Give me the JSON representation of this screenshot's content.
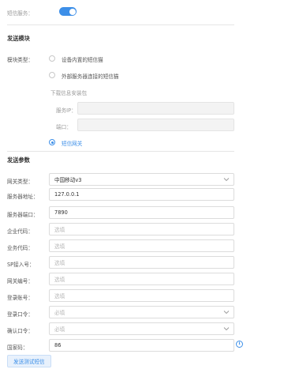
{
  "sms_service": {
    "label": "短信服务：",
    "enabled": true
  },
  "send_module": {
    "title": "发送模块",
    "module_type_label": "模块类型：",
    "options": [
      {
        "label": "设备内置的短信猫",
        "selected": false
      },
      {
        "label": "外部服务器连接的短信猫",
        "selected": false
      },
      {
        "label": "短信网关",
        "selected": true
      }
    ],
    "download_hint": "下载信息安装包",
    "server_ip_label": "服务IP：",
    "port_label": "端口："
  },
  "send_params": {
    "title": "发送参数",
    "fields": [
      {
        "label": "网关类型：",
        "value": "中国移动v3",
        "placeholder": "",
        "type": "select"
      },
      {
        "label": "服务器地址：",
        "value": "127.0.0.1",
        "placeholder": "",
        "type": "text"
      },
      {
        "label": "服务器端口：",
        "value": "7890",
        "placeholder": "",
        "type": "text"
      },
      {
        "label": "企业代码：",
        "value": "",
        "placeholder": "选填",
        "type": "text"
      },
      {
        "label": "业务代码：",
        "value": "",
        "placeholder": "选填",
        "type": "text"
      },
      {
        "label": "SP接入号：",
        "value": "",
        "placeholder": "选填",
        "type": "text"
      },
      {
        "label": "网关编号：",
        "value": "",
        "placeholder": "选填",
        "type": "text"
      },
      {
        "label": "登录账号：",
        "value": "",
        "placeholder": "选填",
        "type": "text"
      },
      {
        "label": "登录口令：",
        "value": "",
        "placeholder": "必填",
        "type": "password"
      },
      {
        "label": "确认口令：",
        "value": "",
        "placeholder": "必填",
        "type": "password"
      },
      {
        "label": "国家码：",
        "value": "86",
        "placeholder": "",
        "type": "text"
      }
    ],
    "info_icon": "info-icon",
    "test_button": "发送测试短信"
  },
  "colors": {
    "accent": "#3d8fe8",
    "border": "#dcdcdc",
    "disabled_bg": "#f3f3f3"
  }
}
